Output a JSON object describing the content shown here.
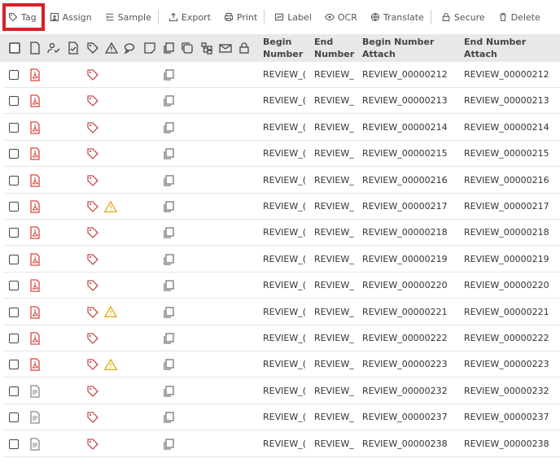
{
  "toolbar": {
    "tag": "Tag",
    "assign": "Assign",
    "sample": "Sample",
    "export": "Export",
    "print": "Print",
    "label": "Label",
    "ocr": "OCR",
    "translate": "Translate",
    "secure": "Secure",
    "delete": "Delete"
  },
  "columns": {
    "begin_number": "Begin\nNumber",
    "end_number": "End\nNumber",
    "begin_attach": "Begin Number\nAttach",
    "end_attach": "End Number\nAttach"
  },
  "header_icons": [
    "checkbox-icon",
    "document-icon",
    "user-check-icon",
    "file-check-icon",
    "tag-icon",
    "warning-icon",
    "chat-icon",
    "note-icon",
    "copy-icon",
    "stack-icon",
    "hierarchy-icon",
    "email-icon",
    "lock-icon"
  ],
  "rows": [
    {
      "type": "pdf",
      "warning": false,
      "begin": "REVIEW_(",
      "end": "REVIEW_",
      "begin_attach": "REVIEW_00000212",
      "end_attach": "REVIEW_00000212"
    },
    {
      "type": "pdf",
      "warning": false,
      "begin": "REVIEW_(",
      "end": "REVIEW_",
      "begin_attach": "REVIEW_00000213",
      "end_attach": "REVIEW_00000213"
    },
    {
      "type": "pdf",
      "warning": false,
      "begin": "REVIEW_(",
      "end": "REVIEW_",
      "begin_attach": "REVIEW_00000214",
      "end_attach": "REVIEW_00000214"
    },
    {
      "type": "pdf",
      "warning": false,
      "begin": "REVIEW_(",
      "end": "REVIEW_",
      "begin_attach": "REVIEW_00000215",
      "end_attach": "REVIEW_00000215"
    },
    {
      "type": "pdf",
      "warning": false,
      "begin": "REVIEW_(",
      "end": "REVIEW_",
      "begin_attach": "REVIEW_00000216",
      "end_attach": "REVIEW_00000216"
    },
    {
      "type": "pdf",
      "warning": true,
      "begin": "REVIEW_(",
      "end": "REVIEW_",
      "begin_attach": "REVIEW_00000217",
      "end_attach": "REVIEW_00000217"
    },
    {
      "type": "pdf",
      "warning": false,
      "begin": "REVIEW_(",
      "end": "REVIEW_",
      "begin_attach": "REVIEW_00000218",
      "end_attach": "REVIEW_00000218"
    },
    {
      "type": "pdf",
      "warning": false,
      "begin": "REVIEW_(",
      "end": "REVIEW_",
      "begin_attach": "REVIEW_00000219",
      "end_attach": "REVIEW_00000219"
    },
    {
      "type": "pdf",
      "warning": false,
      "begin": "REVIEW_(",
      "end": "REVIEW_",
      "begin_attach": "REVIEW_00000220",
      "end_attach": "REVIEW_00000220"
    },
    {
      "type": "pdf",
      "warning": true,
      "begin": "REVIEW_(",
      "end": "REVIEW_",
      "begin_attach": "REVIEW_00000221",
      "end_attach": "REVIEW_00000221"
    },
    {
      "type": "pdf",
      "warning": false,
      "begin": "REVIEW_(",
      "end": "REVIEW_",
      "begin_attach": "REVIEW_00000222",
      "end_attach": "REVIEW_00000222"
    },
    {
      "type": "pdf",
      "warning": true,
      "begin": "REVIEW_(",
      "end": "REVIEW_",
      "begin_attach": "REVIEW_00000223",
      "end_attach": "REVIEW_00000223"
    },
    {
      "type": "text",
      "warning": false,
      "begin": "REVIEW_(",
      "end": "REVIEW_",
      "begin_attach": "REVIEW_00000232",
      "end_attach": "REVIEW_00000232"
    },
    {
      "type": "text",
      "warning": false,
      "begin": "REVIEW_(",
      "end": "REVIEW_",
      "begin_attach": "REVIEW_00000237",
      "end_attach": "REVIEW_00000237"
    },
    {
      "type": "text",
      "warning": false,
      "begin": "REVIEW_(",
      "end": "REVIEW_",
      "begin_attach": "REVIEW_00000238",
      "end_attach": "REVIEW_00000238"
    }
  ],
  "colors": {
    "pdf_red": "#d9463a",
    "tag_red": "#c0504d",
    "warning_amber": "#e0a800",
    "highlight_red": "#d81f26",
    "header_bg": "#e8e8e8"
  }
}
